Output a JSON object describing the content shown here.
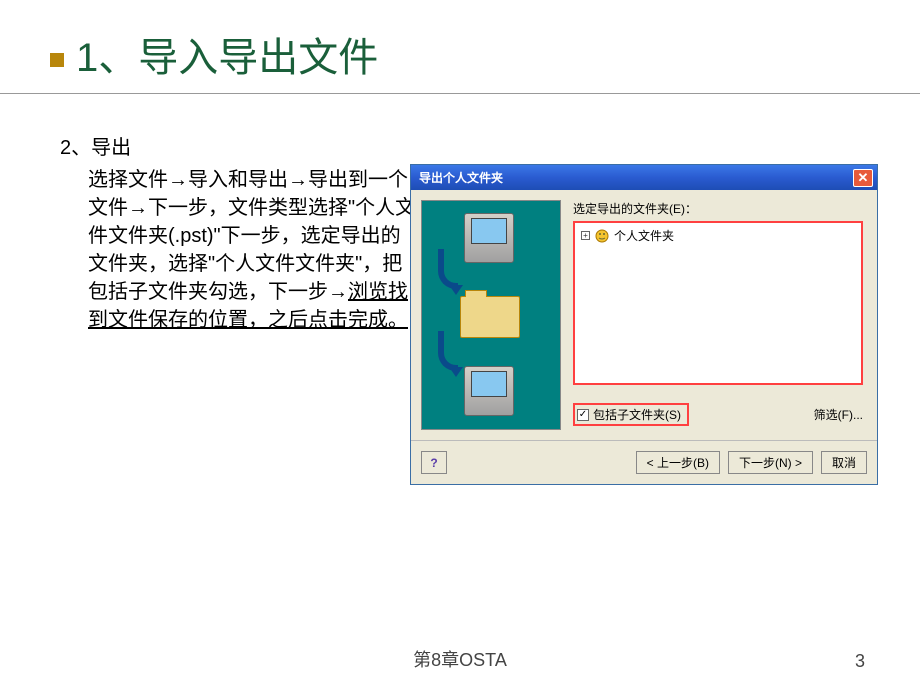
{
  "slide": {
    "title": "1、导入导出文件",
    "sub_heading": "2、导出",
    "body": "选择文件→导入和导出→导出到一个文件→下一步，文件类型选择\"个人文件文件夹(.pst)\"下一步，选定导出的文件夹，选择\"个人文件文件夹\"，把包括子文件夹勾选，下一步→",
    "body_underline": "浏览找到文件保存的位置，之后点击完成。"
  },
  "dialog": {
    "title": "导出个人文件夹",
    "tree_label": "选定导出的文件夹(E)：",
    "tree_item": "个人文件夹",
    "include_sub": "包括子文件夹(S)",
    "filter_btn": "筛选(F)...",
    "prev_btn": "< 上一步(B)",
    "next_btn": "下一步(N) >",
    "cancel_btn": "取消",
    "close": "✕",
    "help": "?",
    "check": "✓",
    "plus": "+"
  },
  "footer": {
    "chapter": "第8章OSTA",
    "page": "3"
  }
}
